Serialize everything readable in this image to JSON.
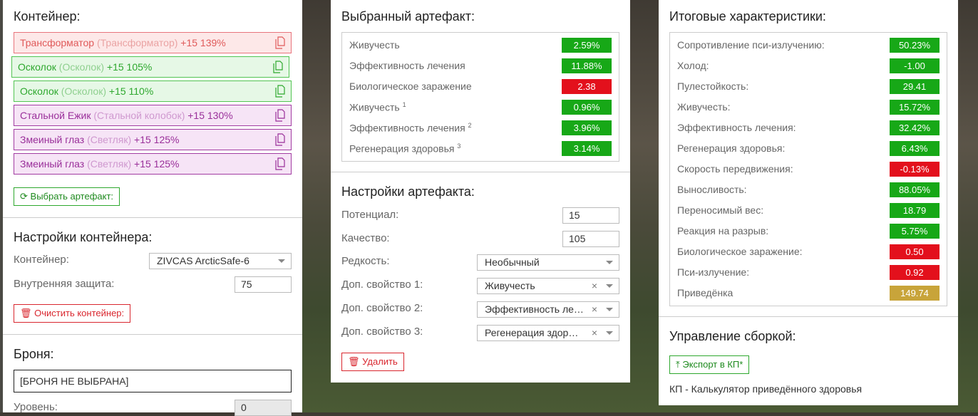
{
  "container_panel": {
    "title": "Контейнер:",
    "items": [
      {
        "name": "Трансформатор",
        "base": "(Трансформатор)",
        "bonus": "+15 139%"
      },
      {
        "name": "Осколок",
        "base": "(Осколок)",
        "bonus": "+15 105%"
      },
      {
        "name": "Осколок",
        "base": "(Осколок)",
        "bonus": "+15 110%"
      },
      {
        "name": "Стальной Ежик",
        "base": "(Стальной колобок)",
        "bonus": "+15 130%"
      },
      {
        "name": "Змеиный глаз",
        "base": "(Светляк)",
        "bonus": "+15 125%"
      },
      {
        "name": "Змеиный глаз",
        "base": "(Светляк)",
        "bonus": "+15 125%"
      }
    ],
    "choose_button": "Выбрать артефакт:",
    "settings_title": "Настройки контейнера:",
    "container_label": "Контейнер:",
    "container_value": "ZIVCAS ArcticSafe-6",
    "inner_protection_label": "Внутренняя защита:",
    "inner_protection_value": "75",
    "clear_button": "Очистить контейнер:",
    "armor_title": "Броня:",
    "armor_value": "[БРОНЯ НЕ ВЫБРАНА]",
    "level_label": "Уровень:",
    "level_value": "0"
  },
  "selected_artifact": {
    "title": "Выбранный артефакт:",
    "stats": [
      {
        "name": "Живучесть",
        "sup": "",
        "value": "2.59%",
        "color": "green"
      },
      {
        "name": "Эффективность лечения",
        "sup": "",
        "value": "11.88%",
        "color": "green"
      },
      {
        "name": "Биологическое заражение",
        "sup": "",
        "value": "2.38",
        "color": "red"
      },
      {
        "name": "Живучесть",
        "sup": "1",
        "value": "0.96%",
        "color": "green"
      },
      {
        "name": "Эффективность лечения",
        "sup": "2",
        "value": "3.96%",
        "color": "green"
      },
      {
        "name": "Регенерация здоровья",
        "sup": "3",
        "value": "3.14%",
        "color": "green"
      }
    ],
    "settings_title": "Настройки артефакта:",
    "potential_label": "Потенциал:",
    "potential_value": "15",
    "quality_label": "Качество:",
    "quality_value": "105",
    "rarity_label": "Редкость:",
    "rarity_value": "Необычный",
    "extra1_label": "Доп. свойство 1:",
    "extra1_value": "Живучесть",
    "extra2_label": "Доп. свойство 2:",
    "extra2_value": "Эффективность ле…",
    "extra3_label": "Доп. свойство 3:",
    "extra3_value": "Регенерация здор…",
    "clear_x": "×",
    "delete_button": "Удалить"
  },
  "totals": {
    "title": "Итоговые характеристики:",
    "stats": [
      {
        "name": "Сопротивление пси-излучению:",
        "value": "50.23%",
        "color": "green"
      },
      {
        "name": "Холод:",
        "value": "-1.00",
        "color": "green"
      },
      {
        "name": "Пулестойкость:",
        "value": "29.41",
        "color": "green"
      },
      {
        "name": "Живучесть:",
        "value": "15.72%",
        "color": "green"
      },
      {
        "name": "Эффективность лечения:",
        "value": "32.42%",
        "color": "green"
      },
      {
        "name": "Регенерация здоровья:",
        "value": "6.43%",
        "color": "green"
      },
      {
        "name": "Скорость передвижения:",
        "value": "-0.13%",
        "color": "red"
      },
      {
        "name": "Выносливость:",
        "value": "88.05%",
        "color": "green"
      },
      {
        "name": "Переносимый вес:",
        "value": "18.79",
        "color": "green"
      },
      {
        "name": "Реакция на разрыв:",
        "value": "5.75%",
        "color": "green"
      },
      {
        "name": "Биологическое заражение:",
        "value": "0.50",
        "color": "red"
      },
      {
        "name": "Пси-излучение:",
        "value": "0.92",
        "color": "red"
      },
      {
        "name": "Приведёнка",
        "value": "149.74",
        "color": "gold"
      }
    ],
    "build_title": "Управление сборкой:",
    "export_button": "Экспорт в КП*",
    "footnote": "КП - Калькулятор приведённого здоровья"
  },
  "colors": {
    "green": "#17a817",
    "red": "#e3101c",
    "gold": "#c8a43a"
  }
}
